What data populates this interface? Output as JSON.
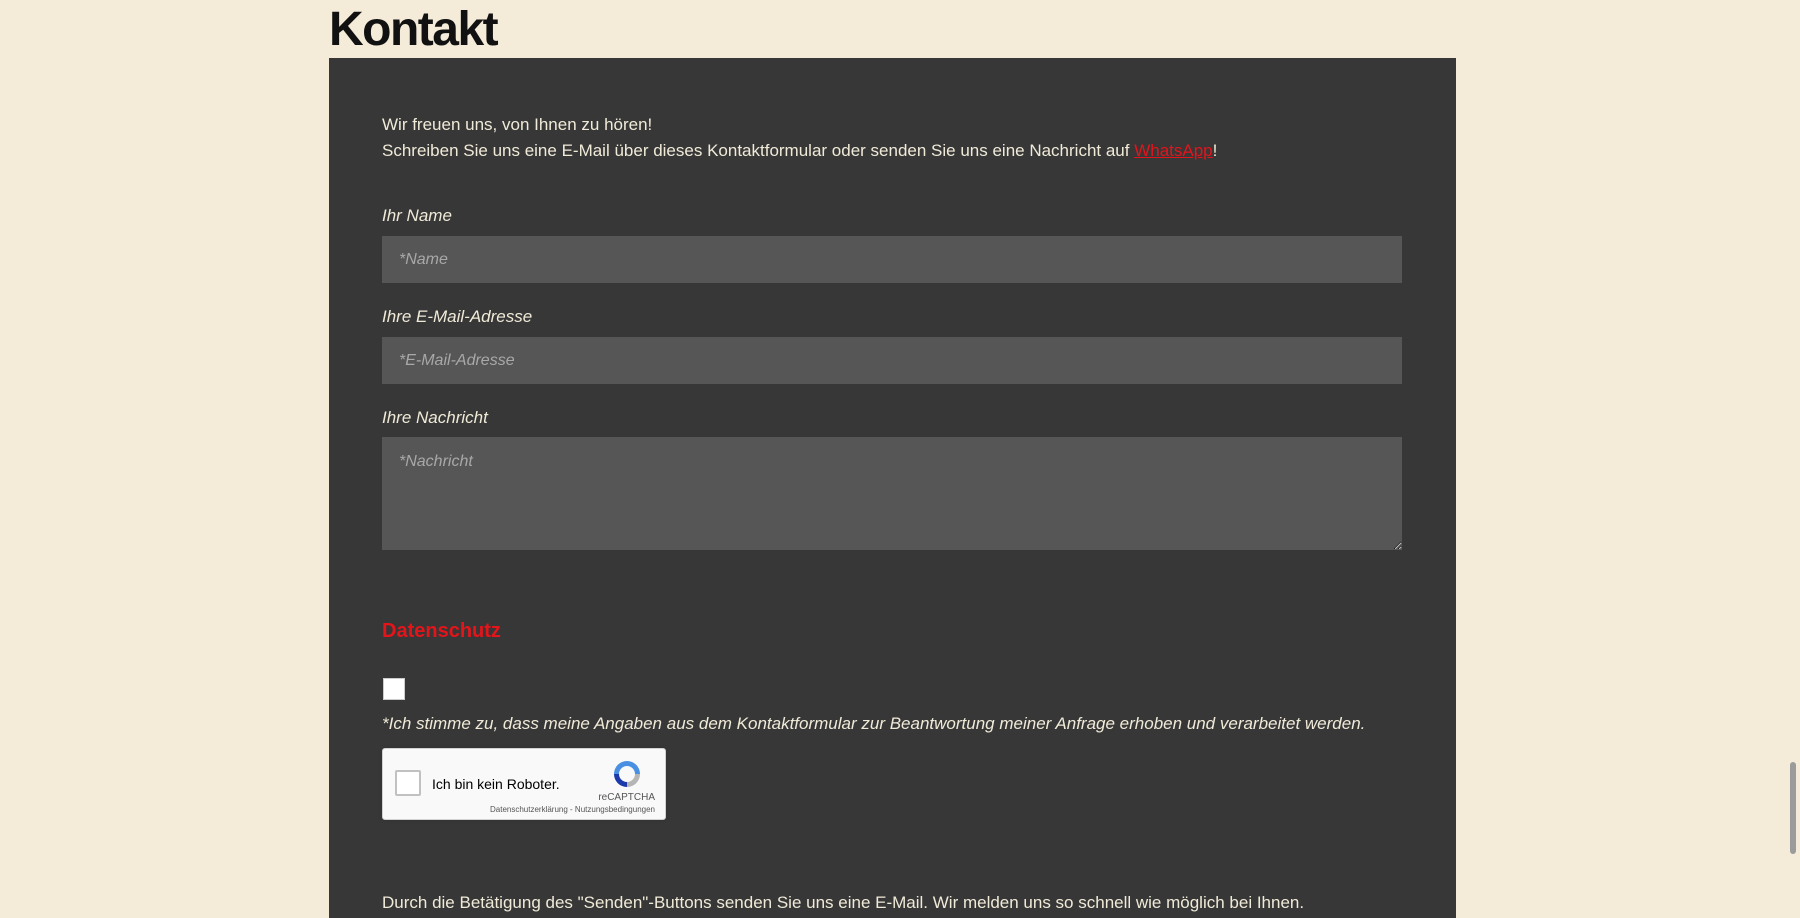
{
  "page": {
    "title": "Kontakt"
  },
  "intro": {
    "line1": "Wir freuen uns, von Ihnen zu hören!",
    "line2_prefix": "Schreiben Sie uns eine E-Mail über dieses Kontaktformular oder senden Sie uns eine Nachricht auf ",
    "link_text": "WhatsApp",
    "line2_suffix": "!"
  },
  "form": {
    "name": {
      "label": "Ihr Name",
      "placeholder": "*Name",
      "value": ""
    },
    "email": {
      "label": "Ihre E-Mail-Adresse",
      "placeholder": "*E-Mail-Adresse",
      "value": ""
    },
    "message": {
      "label": "Ihre Nachricht",
      "placeholder": "*Nachricht",
      "value": ""
    }
  },
  "privacy": {
    "heading": "Datenschutz",
    "consent_checked": false,
    "consent_text": "*Ich stimme zu, dass meine Angaben aus dem Kontaktformular zur Beantwortung meiner Anfrage erhoben und verarbeitet werden."
  },
  "recaptcha": {
    "label": "Ich bin kein Roboter.",
    "brand": "reCAPTCHA",
    "links": "Datenschutzerklärung - Nutzungsbedingungen"
  },
  "footer": {
    "note": "Durch die Betätigung des \"Senden\"-Buttons senden Sie uns eine E-Mail. Wir melden uns so schnell wie möglich bei Ihnen."
  },
  "colors": {
    "background": "#f4ecd9",
    "panel": "#373737",
    "field": "#565656",
    "accent": "#e4141b",
    "text": "#f0ead8"
  }
}
